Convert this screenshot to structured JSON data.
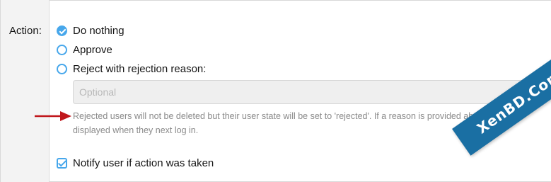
{
  "field": {
    "label": "Action:"
  },
  "options": [
    {
      "label": "Do nothing",
      "checked": true
    },
    {
      "label": "Approve",
      "checked": false
    },
    {
      "label": "Reject with rejection reason:",
      "checked": false
    }
  ],
  "reason": {
    "placeholder": "Optional",
    "value": ""
  },
  "explain": {
    "text": "Rejected users will not be deleted but their user state will be set to 'rejected'. If a reason is provided above, it will be displayed when they next log in."
  },
  "notify": {
    "label": "Notify user if action was taken",
    "checked": true
  },
  "watermark": {
    "text": "XenBD.Com"
  },
  "colors": {
    "accent": "#47a7eb",
    "arrow": "#c0161b",
    "label_bg": "#f3f3f3",
    "watermark_band": "#1a6fa3"
  },
  "icons": {
    "radio_checked": "radio-checked-icon",
    "radio": "radio-icon",
    "checkbox": "checkbox-checked-icon",
    "arrow": "red-arrow-icon"
  }
}
